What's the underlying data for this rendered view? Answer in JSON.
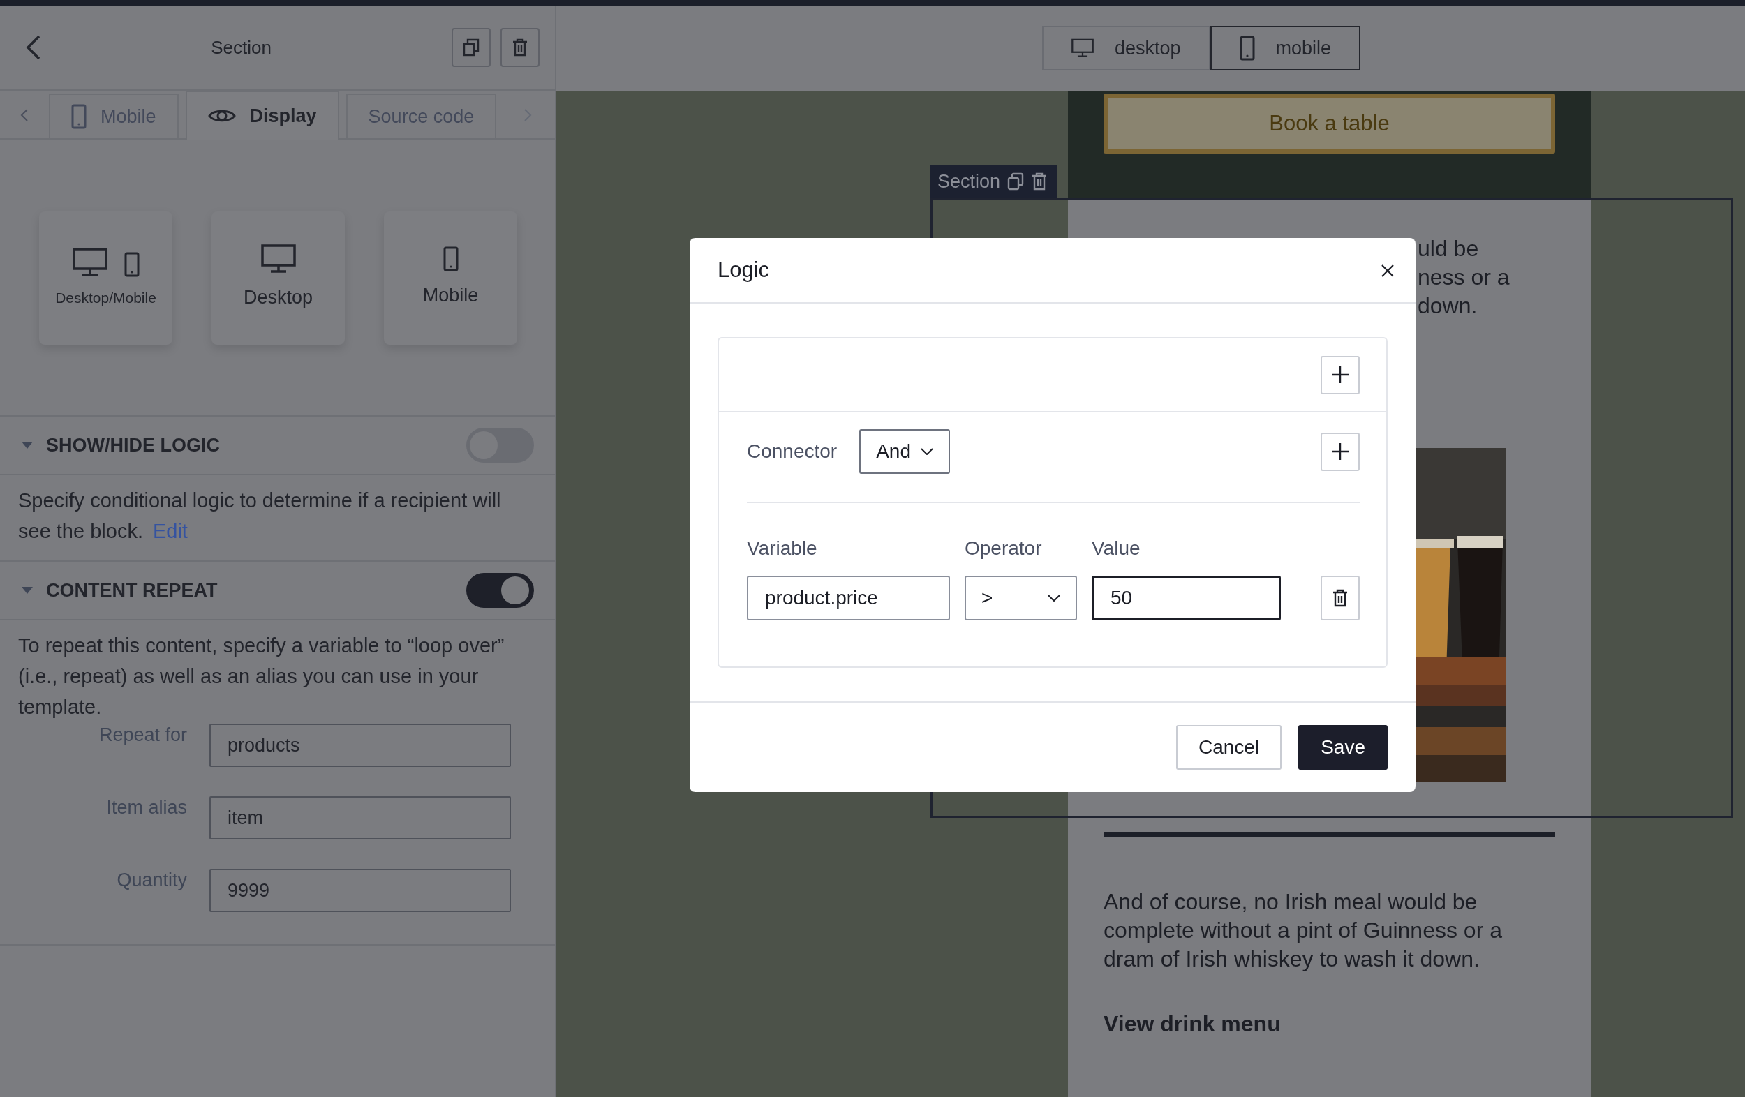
{
  "sidebar": {
    "title": "Section",
    "tabs": [
      {
        "label": "Mobile",
        "kind": "phone",
        "selected": false
      },
      {
        "label": "Display",
        "kind": "eye",
        "selected": true
      },
      {
        "label": "Source code",
        "kind": "plain",
        "selected": false
      }
    ],
    "display_options": [
      {
        "label": "Desktop/Mobile",
        "kind": "both"
      },
      {
        "label": "Desktop",
        "kind": "desktop"
      },
      {
        "label": "Mobile",
        "kind": "mobile"
      }
    ],
    "sections": [
      {
        "title": "SHOW/HIDE LOGIC",
        "expanded": true,
        "on": false,
        "description": "Specify conditional logic to determine if a recipient will see the block.",
        "link": "Edit"
      },
      {
        "title": "CONTENT REPEAT",
        "expanded": true,
        "on": true,
        "description": "To repeat this content, specify a variable to “loop over” (i.e., repeat) as well as an alias you can use in your template.",
        "fields": [
          {
            "label": "Repeat for",
            "value": "products"
          },
          {
            "label": "Item alias",
            "value": "item"
          },
          {
            "label": "Quantity",
            "value": "9999"
          }
        ]
      }
    ]
  },
  "preview_toolbar": {
    "views": [
      {
        "label": "desktop",
        "kind": "desktop",
        "selected": false
      },
      {
        "label": "mobile",
        "kind": "mobile",
        "selected": true
      }
    ]
  },
  "email_preview": {
    "button": "Book a table",
    "section_label": "Section",
    "partial_lines": [
      "uld be",
      "ness or a",
      "down."
    ],
    "paragraph": "And of course, no Irish meal would be complete without a pint of Guinness or a dram of Irish whiskey to wash it down.",
    "link": "View drink menu"
  },
  "modal": {
    "title": "Logic",
    "connector_label": "Connector",
    "connector": "And",
    "condition": {
      "labels": [
        "Variable",
        "Operator",
        "Value"
      ],
      "variable": "product.price",
      "operator": ">",
      "value": "50",
      "value_focused": true
    },
    "buttons": [
      {
        "label": "Cancel",
        "kind": "secondary"
      },
      {
        "label": "Save",
        "kind": "primary"
      }
    ]
  }
}
